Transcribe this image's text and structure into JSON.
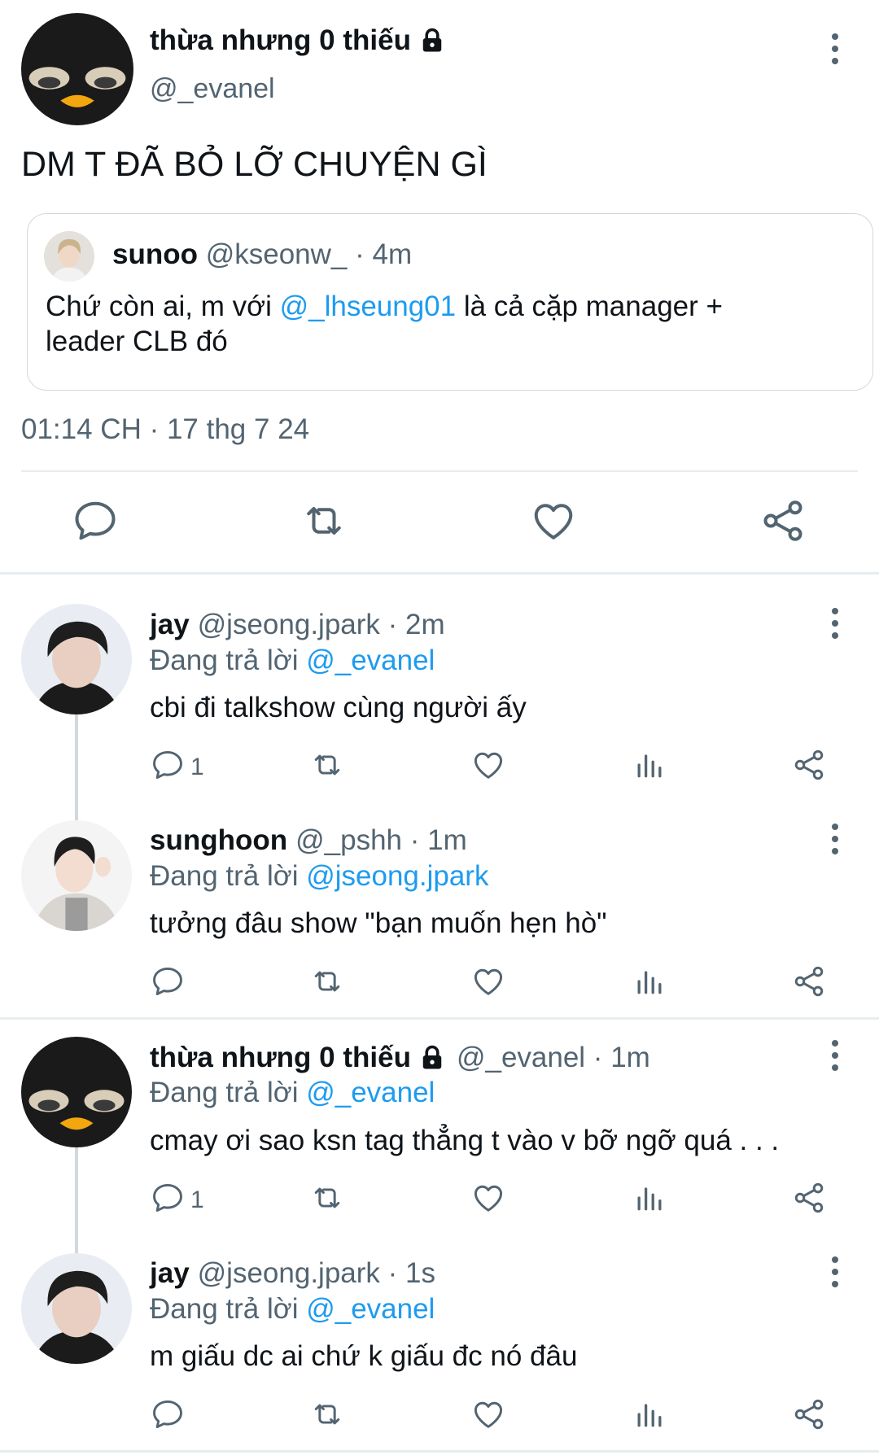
{
  "main": {
    "name": "thừa nhưng 0 thiếu",
    "handle": "@_evanel",
    "text": "DM T ĐÃ BỎ LỠ CHUYỆN GÌ",
    "quote": {
      "name": "sunoo",
      "handle_time": "@kseonw_ · 4m",
      "text_before": "Chứ còn ai, m với ",
      "mention": "@_lhseung01",
      "text_after": " là cả cặp manager +",
      "text_line2": "leader CLB đó"
    },
    "timestamp": "01:14 CH · 17 thg 7 24"
  },
  "replies": [
    {
      "name": "jay",
      "handle_time": "@jseong.jpark · 2m",
      "replying_label": "Đang trả lời ",
      "replying_to": "@_evanel",
      "text": "cbi đi talkshow cùng người ấy",
      "reply_count": "1"
    },
    {
      "name": "sunghoon",
      "handle_time": "@_pshh · 1m",
      "replying_label": "Đang trả lời ",
      "replying_to": "@jseong.jpark",
      "text": "tưởng đâu show \"bạn muốn hẹn hò\"",
      "reply_count": ""
    },
    {
      "name": "thừa nhưng 0 thiếu",
      "handle_time": "@_evanel · 1m",
      "replying_label": "Đang trả lời ",
      "replying_to": "@_evanel",
      "text": "cmay ơi sao ksn tag thẳng t vào v bỡ ngỡ quá . . .",
      "reply_count": "1"
    },
    {
      "name": "jay",
      "handle_time": "@jseong.jpark · 1s",
      "replying_label": "Đang trả lời ",
      "replying_to": "@_evanel",
      "text": "m giấu dc ai chứ k giấu đc nó đâu",
      "reply_count": ""
    }
  ],
  "icons": {
    "reply": "reply-icon",
    "retweet": "retweet-icon",
    "like": "heart-icon",
    "views": "views-icon",
    "share": "share-icon",
    "more": "more-vertical-icon",
    "lock": "lock-icon"
  },
  "colors": {
    "link": "#1d9bf0",
    "muted": "#536471",
    "text": "#0f1419",
    "divider": "#e7ecef"
  }
}
